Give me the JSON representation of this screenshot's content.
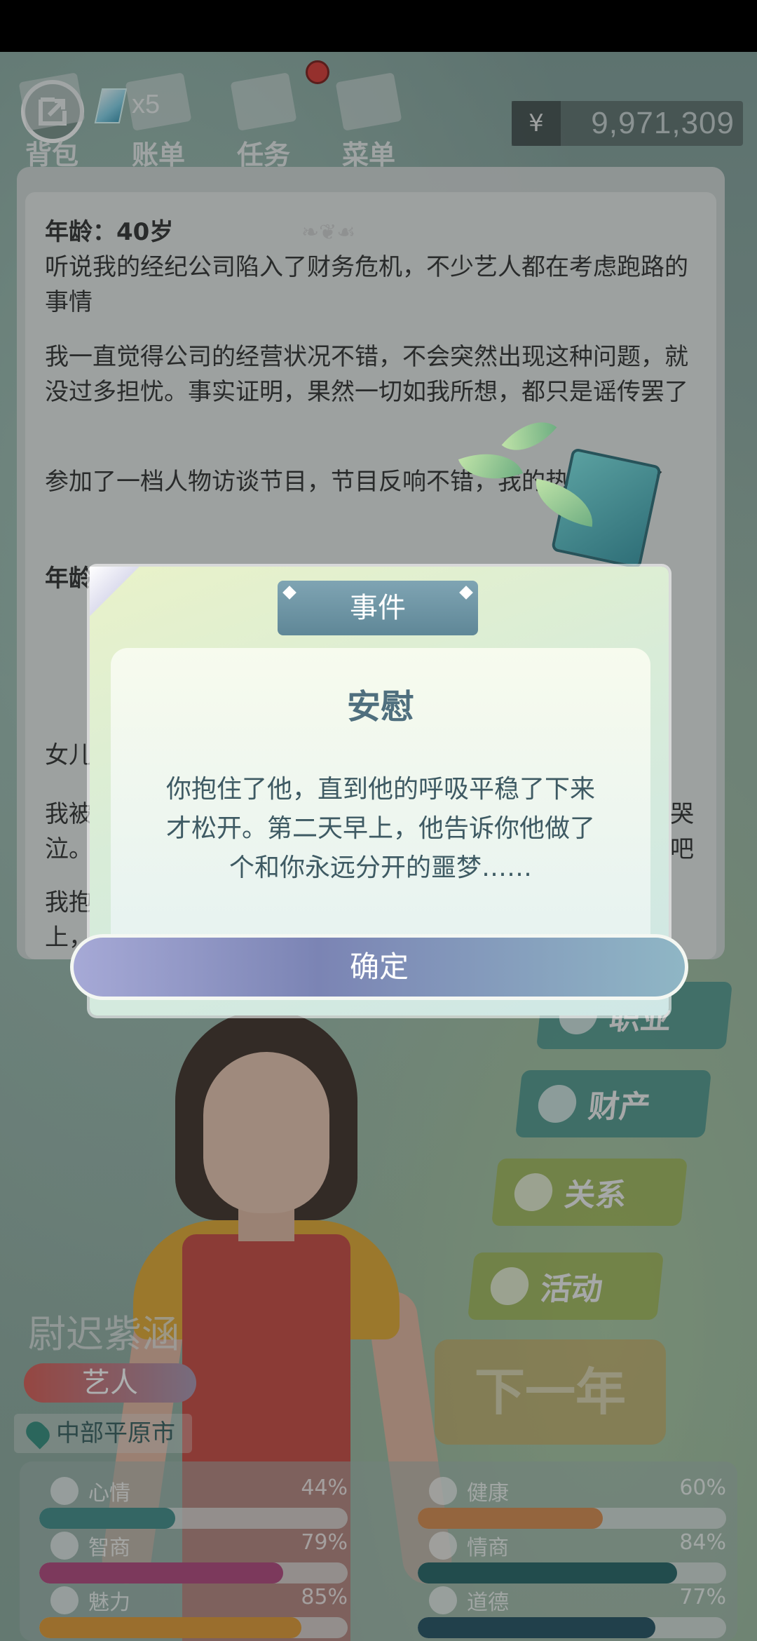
{
  "topbar": {
    "gem_count": "x5",
    "tabs": [
      "背包",
      "账单",
      "任务",
      "菜单"
    ],
    "money_symbol": "¥",
    "money_amount": "9,971,309"
  },
  "journal": {
    "entries": [
      {
        "age": "年龄：40岁",
        "paragraphs": [
          "听说我的经纪公司陷入了财务危机，不少艺人都在考虑跑路的事情",
          "我一直觉得公司的经营状况不错，不会突然出现这种问题，就没过多担忧。事实证明，果然一切如我所想，都只是谣传罢了",
          "参加了一档人物访谈节目，节目反响不错，我的热度提升了"
        ]
      },
      {
        "age": "年龄：",
        "paragraphs": [
          "女儿",
          "我被",
          "泣。",
          "我抱",
          "上，"
        ]
      }
    ],
    "side_text": [
      "哭",
      "吧"
    ]
  },
  "modal": {
    "header": "事件",
    "title": "安慰",
    "message_lines": [
      "你抱住了他，直到他的呼吸平稳了下来",
      "才松开。第二天早上，他告诉你他做了",
      "个和你永远分开的噩梦……"
    ],
    "confirm_label": "确定"
  },
  "side_menu": [
    {
      "label": "职业",
      "color": "#3f8f88"
    },
    {
      "label": "财产",
      "color": "#3f8f88"
    },
    {
      "label": "关系",
      "color": "#9fb54c"
    },
    {
      "label": "活动",
      "color": "#9fb54c"
    }
  ],
  "profile": {
    "name": "尉迟紫涵",
    "job": "艺人",
    "location": "中部平原市",
    "next_year_label": "下一年"
  },
  "stats": [
    {
      "label": "心情",
      "percent": "44%",
      "value": 0.44,
      "color": "#3c8a86",
      "icon": "smile-icon"
    },
    {
      "label": "健康",
      "percent": "60%",
      "value": 0.6,
      "color": "#d7884a",
      "icon": "heart-icon"
    },
    {
      "label": "智商",
      "percent": "79%",
      "value": 0.79,
      "color": "#b0417a",
      "icon": "bulb-icon"
    },
    {
      "label": "情商",
      "percent": "84%",
      "value": 0.84,
      "color": "#1f5f62",
      "icon": "apple-icon"
    },
    {
      "label": "魅力",
      "percent": "85%",
      "value": 0.85,
      "color": "#e0962e",
      "icon": "sparkle-icon"
    },
    {
      "label": "道德",
      "percent": "77%",
      "value": 0.77,
      "color": "#1d4c5e",
      "icon": "scale-icon"
    }
  ]
}
